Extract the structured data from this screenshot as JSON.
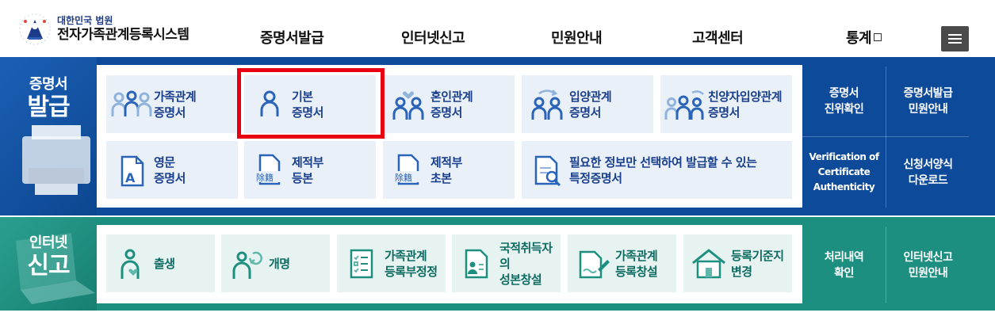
{
  "header": {
    "logo_sub": "대한민국 법원",
    "logo_main": "전자가족관계등록시스템",
    "nav": [
      "증명서발급",
      "인터넷신고",
      "민원안내",
      "고객센터",
      "통계"
    ]
  },
  "issue": {
    "label_small": "증명서",
    "label_large": "발급",
    "cards": [
      {
        "line1": "가족관계",
        "line2": "증명서",
        "icon": "family-icon"
      },
      {
        "line1": "기본",
        "line2": "증명서",
        "icon": "person-icon"
      },
      {
        "line1": "혼인관계",
        "line2": "증명서",
        "icon": "marriage-icon"
      },
      {
        "line1": "입양관계",
        "line2": "증명서",
        "icon": "adoption-icon"
      },
      {
        "line1": "친양자입양관계",
        "line2": "증명서",
        "icon": "full-adoption-icon"
      },
      {
        "line1": "영문",
        "line2": "증명서",
        "icon": "english-doc-icon"
      },
      {
        "line1": "제적부",
        "line2": "등본",
        "icon": "removal-doc-icon"
      },
      {
        "line1": "제적부",
        "line2": "초본",
        "icon": "removal-doc-icon"
      },
      {
        "line1": "필요한 정보만 선택하여 발급할 수 있는",
        "line2": "특정증명서",
        "icon": "search-doc-icon"
      }
    ],
    "stamp": "除籍",
    "english_letter": "A",
    "side": [
      {
        "line1": "증명서",
        "line2": "진위확인"
      },
      {
        "line1": "증명서발급",
        "line2": "민원안내"
      },
      {
        "line1": "Verification of",
        "line2": "Certificate",
        "line3": "Authenticity"
      },
      {
        "line1": "신청서양식",
        "line2": "다운로드"
      }
    ]
  },
  "report": {
    "label_small": "인터넷",
    "label_large": "신고",
    "cards": [
      {
        "line1": "출생",
        "line2": "",
        "icon": "birth-icon"
      },
      {
        "line1": "개명",
        "line2": "",
        "icon": "rename-icon"
      },
      {
        "line1": "가족관계",
        "line2": "등록부정정",
        "icon": "checklist-icon"
      },
      {
        "line1": "국적취득자의",
        "line2": "성본창설",
        "icon": "id-card-icon"
      },
      {
        "line1": "가족관계",
        "line2": "등록창설",
        "icon": "write-doc-icon"
      },
      {
        "line1": "등록기준지",
        "line2": "변경",
        "icon": "house-icon"
      }
    ],
    "side": [
      {
        "line1": "처리내역",
        "line2": "확인"
      },
      {
        "line1": "인터넷신고",
        "line2": "민원안내"
      }
    ]
  },
  "colors": {
    "issue_band": "#0d4a9a",
    "report_band": "#1d8f80",
    "issue_text": "#1a3f8c",
    "report_text": "#0e6b61",
    "highlight": "#e60012"
  }
}
